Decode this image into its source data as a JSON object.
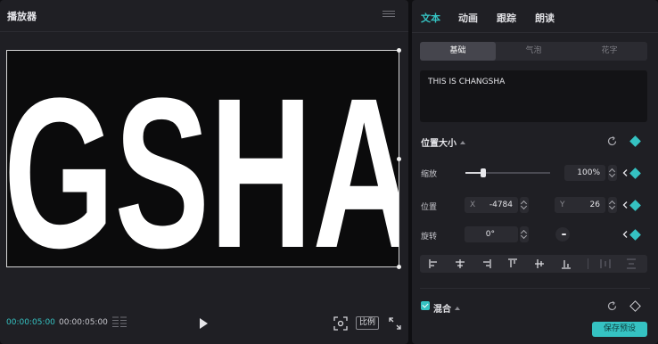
{
  "player": {
    "title": "播放器",
    "canvas_text": "GSHA",
    "time_current": "00:00:05:00",
    "time_total": "00:00:05:00",
    "ratio_label": "比例"
  },
  "inspector": {
    "tabs": [
      "文本",
      "动画",
      "跟踪",
      "朗读"
    ],
    "active_tab": "文本",
    "subtabs": [
      "基础",
      "气泡",
      "花字"
    ],
    "active_subtab": "基础",
    "text_content": "THIS IS CHANGSHA",
    "position_size": {
      "title": "位置大小",
      "scale_label": "缩放",
      "scale_value": "100%",
      "scale_fraction": 0.22,
      "position_label": "位置",
      "x_axis": "X",
      "x_value": "-4784",
      "y_axis": "Y",
      "y_value": "26",
      "rotate_label": "旋转",
      "rotate_value": "0°"
    },
    "blend": {
      "title": "混合",
      "checked": true
    },
    "save_preset": "保存预设"
  },
  "colors": {
    "accent": "#35c2c2",
    "panel": "#1f1f24",
    "background": "#0f0f12"
  },
  "icons": [
    "menu-icon",
    "timeline-icon",
    "play-icon",
    "fit-screen-icon",
    "fullscreen-icon",
    "reset-icon",
    "keyframe-diamond-icon",
    "chevron-left-icon",
    "align-left-icon",
    "align-center-icon",
    "align-right-icon",
    "align-top-icon",
    "align-middle-icon",
    "align-bottom-icon",
    "distribute-horizontal-icon",
    "distribute-vertical-icon"
  ]
}
